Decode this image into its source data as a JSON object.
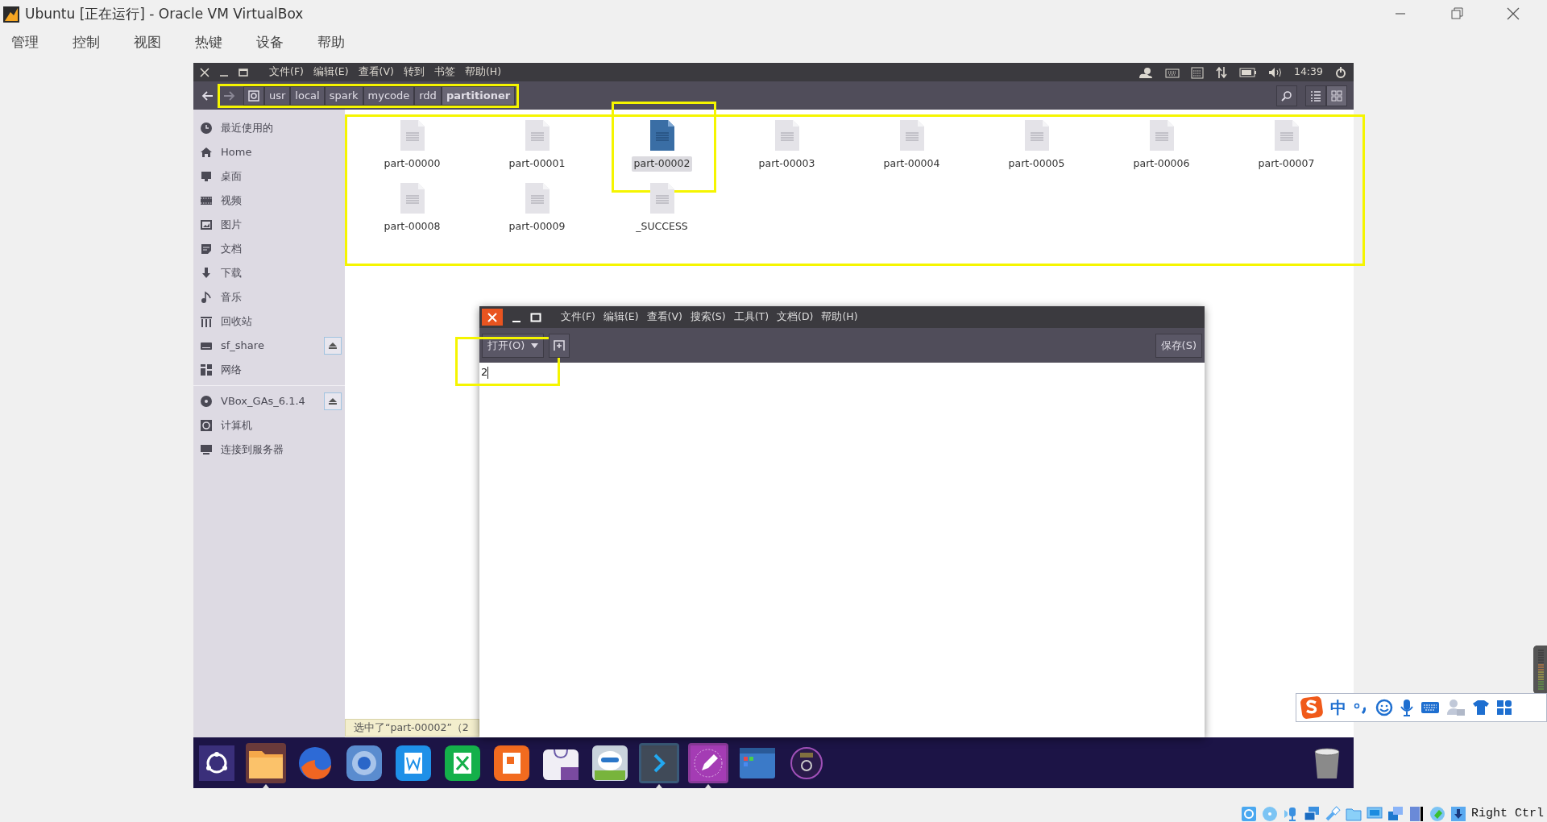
{
  "window": {
    "title": "Ubuntu [正在运行] - Oracle VM VirtualBox"
  },
  "menu": [
    "管理",
    "控制",
    "视图",
    "热键",
    "设备",
    "帮助"
  ],
  "panel": {
    "menus": [
      "文件(F)",
      "编辑(E)",
      "查看(V)",
      "转到",
      "书签",
      "帮助(H)"
    ],
    "clock": "14:39"
  },
  "files": {
    "path_highlighted": true,
    "path": [
      {
        "label": "usr",
        "selected": false
      },
      {
        "label": "local",
        "selected": false
      },
      {
        "label": "spark",
        "selected": false
      },
      {
        "label": "mycode",
        "selected": false
      },
      {
        "label": "rdd",
        "selected": false
      },
      {
        "label": "partitioner",
        "selected": true
      }
    ],
    "view_buttons": [
      {
        "kind": "list",
        "selected": false
      },
      {
        "kind": "grid",
        "selected": true
      }
    ],
    "sidebar": [
      [
        {
          "label": "最近使用的",
          "kind": "recent",
          "eject": false
        },
        {
          "label": "Home",
          "kind": "home",
          "eject": false
        },
        {
          "label": "桌面",
          "kind": "desktop",
          "eject": false
        },
        {
          "label": "视频",
          "kind": "video",
          "eject": false
        },
        {
          "label": "图片",
          "kind": "pictures",
          "eject": false
        },
        {
          "label": "文档",
          "kind": "documents",
          "eject": false
        },
        {
          "label": "下载",
          "kind": "downloads",
          "eject": false
        },
        {
          "label": "音乐",
          "kind": "music",
          "eject": false
        },
        {
          "label": "回收站",
          "kind": "trash",
          "eject": false
        },
        {
          "label": "sf_share",
          "kind": "drive",
          "eject": true
        },
        {
          "label": "网络",
          "kind": "network",
          "eject": false
        }
      ],
      [
        {
          "label": "VBox_GAs_6.1.4",
          "kind": "disc",
          "eject": true
        },
        {
          "label": "计算机",
          "kind": "computer",
          "eject": false
        },
        {
          "label": "连接到服务器",
          "kind": "server",
          "eject": false
        }
      ]
    ],
    "grid_highlighted": true,
    "items": [
      {
        "name": "part-00000",
        "selected": false,
        "highlighted": false
      },
      {
        "name": "part-00001",
        "selected": false,
        "highlighted": false
      },
      {
        "name": "part-00002",
        "selected": true,
        "highlighted": true
      },
      {
        "name": "part-00003",
        "selected": false,
        "highlighted": false
      },
      {
        "name": "part-00004",
        "selected": false,
        "highlighted": false
      },
      {
        "name": "part-00005",
        "selected": false,
        "highlighted": false
      },
      {
        "name": "part-00006",
        "selected": false,
        "highlighted": false
      },
      {
        "name": "part-00007",
        "selected": false,
        "highlighted": false
      },
      {
        "name": "part-00008",
        "selected": false,
        "highlighted": false
      },
      {
        "name": "part-00009",
        "selected": false,
        "highlighted": false
      },
      {
        "name": "_SUCCESS",
        "selected": false,
        "highlighted": false
      }
    ],
    "status": "选中了“part-00002”（2"
  },
  "editor": {
    "menus": [
      "文件(F)",
      "编辑(E)",
      "查看(V)",
      "搜索(S)",
      "工具(T)",
      "文档(D)",
      "帮助(H)"
    ],
    "open_button": {
      "label": "打开(O)",
      "highlighted": true
    },
    "save_button": "保存(S)",
    "content": "2"
  },
  "dock": [
    {
      "kind": "launcher",
      "running": false
    },
    {
      "kind": "files",
      "running": true
    },
    {
      "kind": "fox",
      "running": false
    },
    {
      "kind": "globe",
      "running": false
    },
    {
      "kind": "word",
      "running": false
    },
    {
      "kind": "sheet",
      "running": false
    },
    {
      "kind": "slides",
      "running": false
    },
    {
      "kind": "bag",
      "running": false
    },
    {
      "kind": "robot",
      "running": false
    },
    {
      "kind": "terminal",
      "running": true
    },
    {
      "kind": "pen",
      "running": true
    },
    {
      "kind": "window",
      "running": false
    },
    {
      "kind": "disc",
      "running": false
    }
  ],
  "ime": {
    "mode": "中"
  },
  "host_status": {
    "host_key": "Right Ctrl"
  }
}
